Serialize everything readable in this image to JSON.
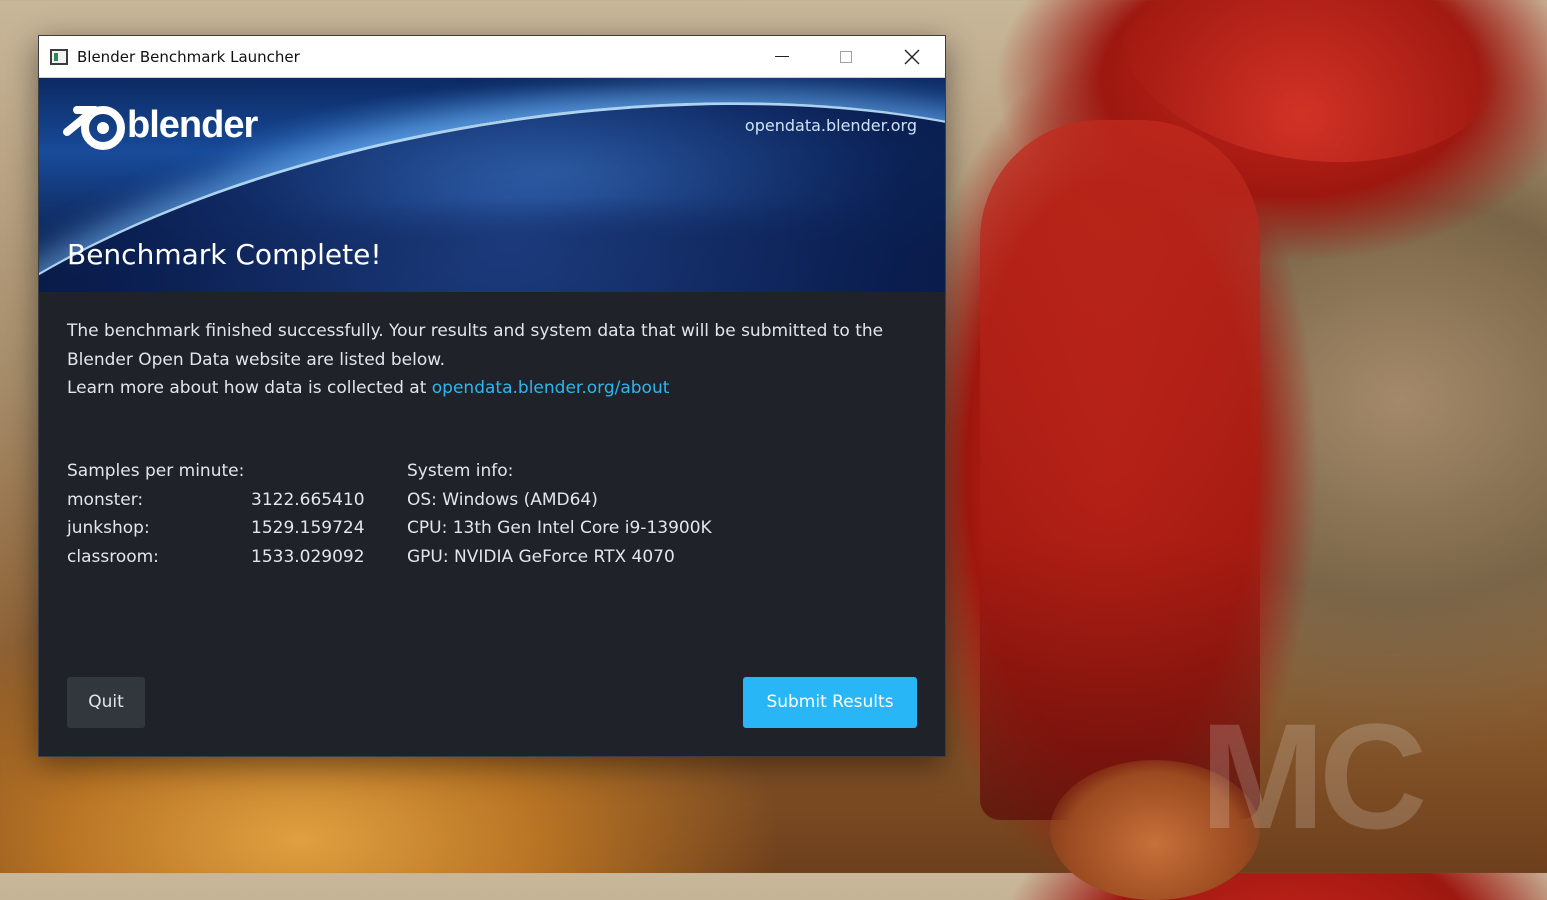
{
  "window": {
    "title": "Blender Benchmark Launcher"
  },
  "banner": {
    "logo_text": "blender",
    "site": "opendata.blender.org",
    "heading": "Benchmark Complete!"
  },
  "message": {
    "line1": "The benchmark finished successfully. Your results and system data that will be submitted to the",
    "line2": "Blender Open Data website are listed below.",
    "line3_prefix": "Learn more about how data is collected at ",
    "line3_link": "opendata.blender.org/about"
  },
  "results": {
    "header": "Samples per minute:",
    "items": [
      {
        "label": "monster:",
        "value": "3122.665410"
      },
      {
        "label": "junkshop:",
        "value": "1529.159724"
      },
      {
        "label": "classroom:",
        "value": "1533.029092"
      }
    ]
  },
  "system": {
    "header": "System info:",
    "os": "OS: Windows (AMD64)",
    "cpu": "CPU: 13th Gen Intel Core i9-13900K",
    "gpu": "GPU: NVIDIA GeForce RTX 4070"
  },
  "buttons": {
    "quit": "Quit",
    "submit": "Submit Results"
  },
  "wallpaper": {
    "watermark": "MC"
  },
  "colors": {
    "accent": "#29b6f6",
    "link": "#2fb6ee",
    "panel_bg": "#1f2228"
  }
}
